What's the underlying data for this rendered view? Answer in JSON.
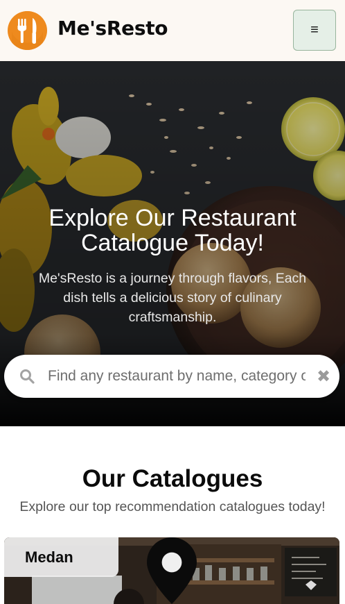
{
  "header": {
    "brand": "Me'sResto",
    "menu_label": "≡",
    "logo_icon": "fork-knife-icon",
    "accent": "#ee8a1e"
  },
  "hero": {
    "title": "Explore Our Restaurant Catalogue Today!",
    "subtitle": "Me'sResto is a journey through flavors, Each dish tells a delicious story of culinary craftsmanship."
  },
  "search": {
    "placeholder": "Find any restaurant by name, category or menu",
    "value": "",
    "clear_label": "✖"
  },
  "catalogues": {
    "title": "Our Catalogues",
    "subtitle": "Explore our top recommendation catalogues today!",
    "cards": [
      {
        "city": "Medan"
      }
    ]
  }
}
